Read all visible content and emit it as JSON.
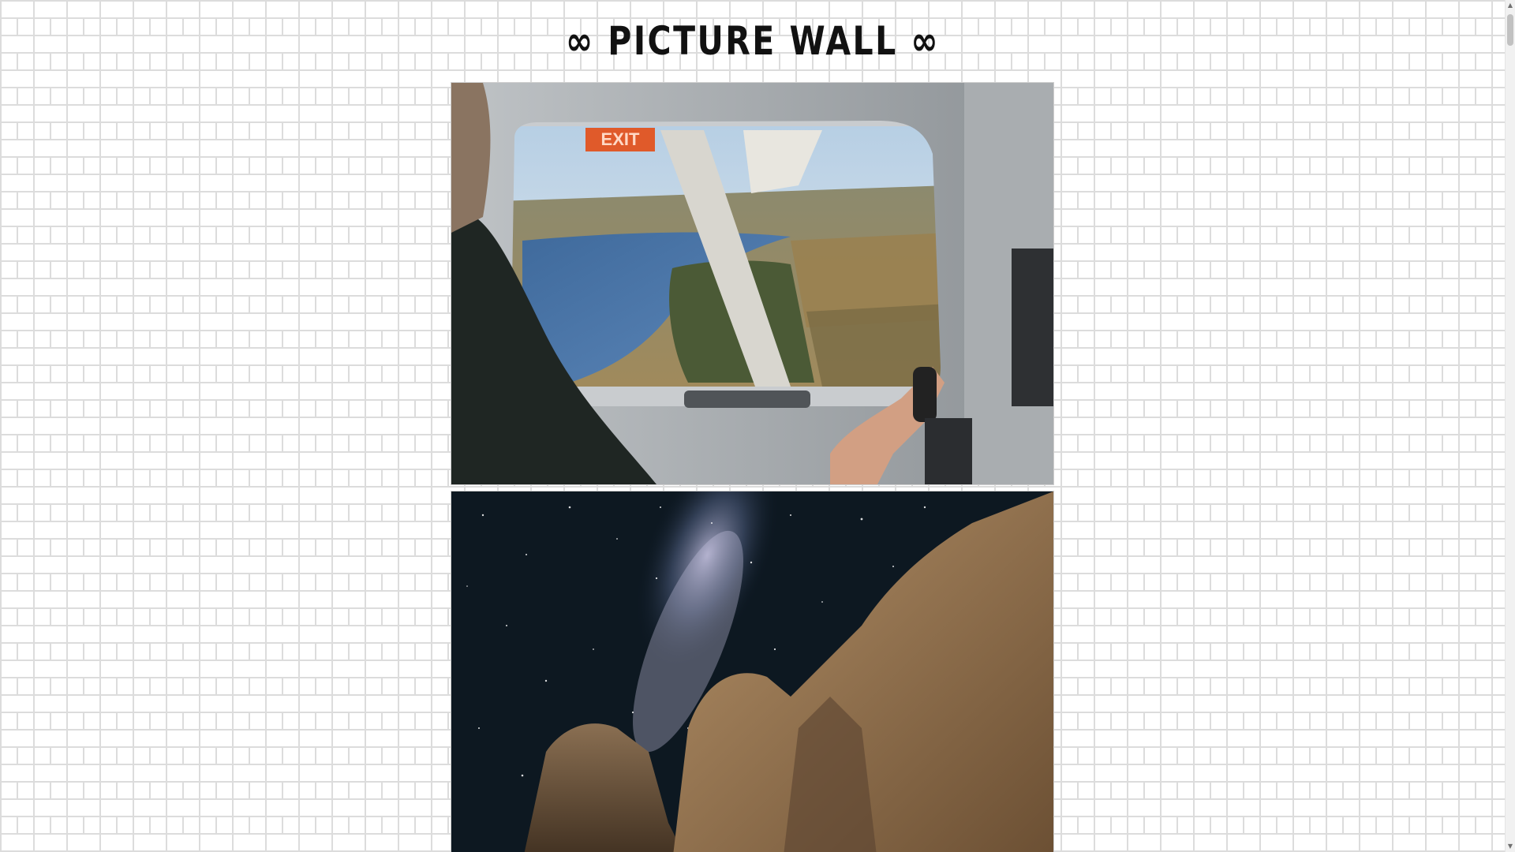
{
  "header": {
    "title": "∞ PICTURE WALL ∞"
  },
  "gallery": {
    "photos": [
      {
        "exit_sign": "EXIT"
      },
      {}
    ]
  },
  "icons": {
    "scroll_up": "scroll-up-arrow-icon",
    "scroll_down": "scroll-down-arrow-icon"
  },
  "colors": {
    "title": "#111111",
    "brick_line": "#dcdcdc",
    "background": "#ffffff"
  }
}
